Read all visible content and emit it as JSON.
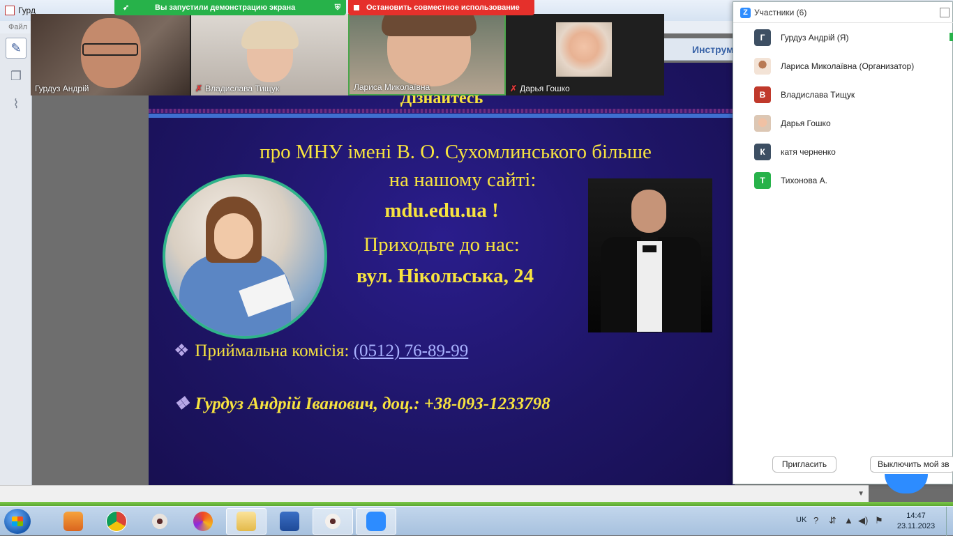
{
  "app": {
    "title": "Гурд",
    "menu": "Файл"
  },
  "toolbar": {
    "instruments_label": "Инструм"
  },
  "slide": {
    "cut_heading": "Дізнайтесь",
    "line1": "про МНУ імені В. О. Сухомлинського більше",
    "line2": "на нашому сайті:",
    "line3": "mdu.edu.ua !",
    "line4": "Приходьте до нас:",
    "line5": "вул. Нікольська, 24",
    "bullet1_label": "Приймальна комісія",
    "bullet1_sep": ": ",
    "bullet1_phone": "(0512) 76-89-99",
    "bullet2": "Гурдуз Андрій Іванович, доц.: +38-093-1233798",
    "bullet_glyph": "❖"
  },
  "video": {
    "tiles": [
      {
        "name": "Гурдуз Андрій",
        "muted": false
      },
      {
        "name": "Владислава Тищук",
        "muted": true
      },
      {
        "name": "Лариса Миколаївна",
        "muted": false
      },
      {
        "name": "Дарья Гошко",
        "muted": true
      }
    ],
    "mute_glyph": "✗"
  },
  "share": {
    "notice": "Вы запустили демонстрацию экрана",
    "stop": "Остановить совместное использование"
  },
  "participants": {
    "title": "Участники (6)",
    "list": [
      {
        "initial": "Г",
        "name": "Гурдуз Андрій (Я)",
        "color": "#3d4f63"
      },
      {
        "initial": "",
        "name": "Лариса Миколаївна (Организатор)",
        "color": "#e8d6c8"
      },
      {
        "initial": "В",
        "name": "Владислава Тищук",
        "color": "#c0392b"
      },
      {
        "initial": "",
        "name": "Дарья Гошко",
        "color": "#e9c2a6"
      },
      {
        "initial": "К",
        "name": "катя черненко",
        "color": "#3d4f63"
      },
      {
        "initial": "Т",
        "name": "Тихонова А.",
        "color": "#27b24a"
      }
    ],
    "invite": "Пригласить",
    "mute_all": "Выключить мой зв"
  },
  "taskbar": {
    "lang": "UK",
    "time": "14:47",
    "date": "23.11.2023"
  },
  "colors": {
    "slide_text": "#f7e33f",
    "zoom_blue": "#2d8cff",
    "share_green": "#27b24a",
    "stop_red": "#e5302b"
  }
}
